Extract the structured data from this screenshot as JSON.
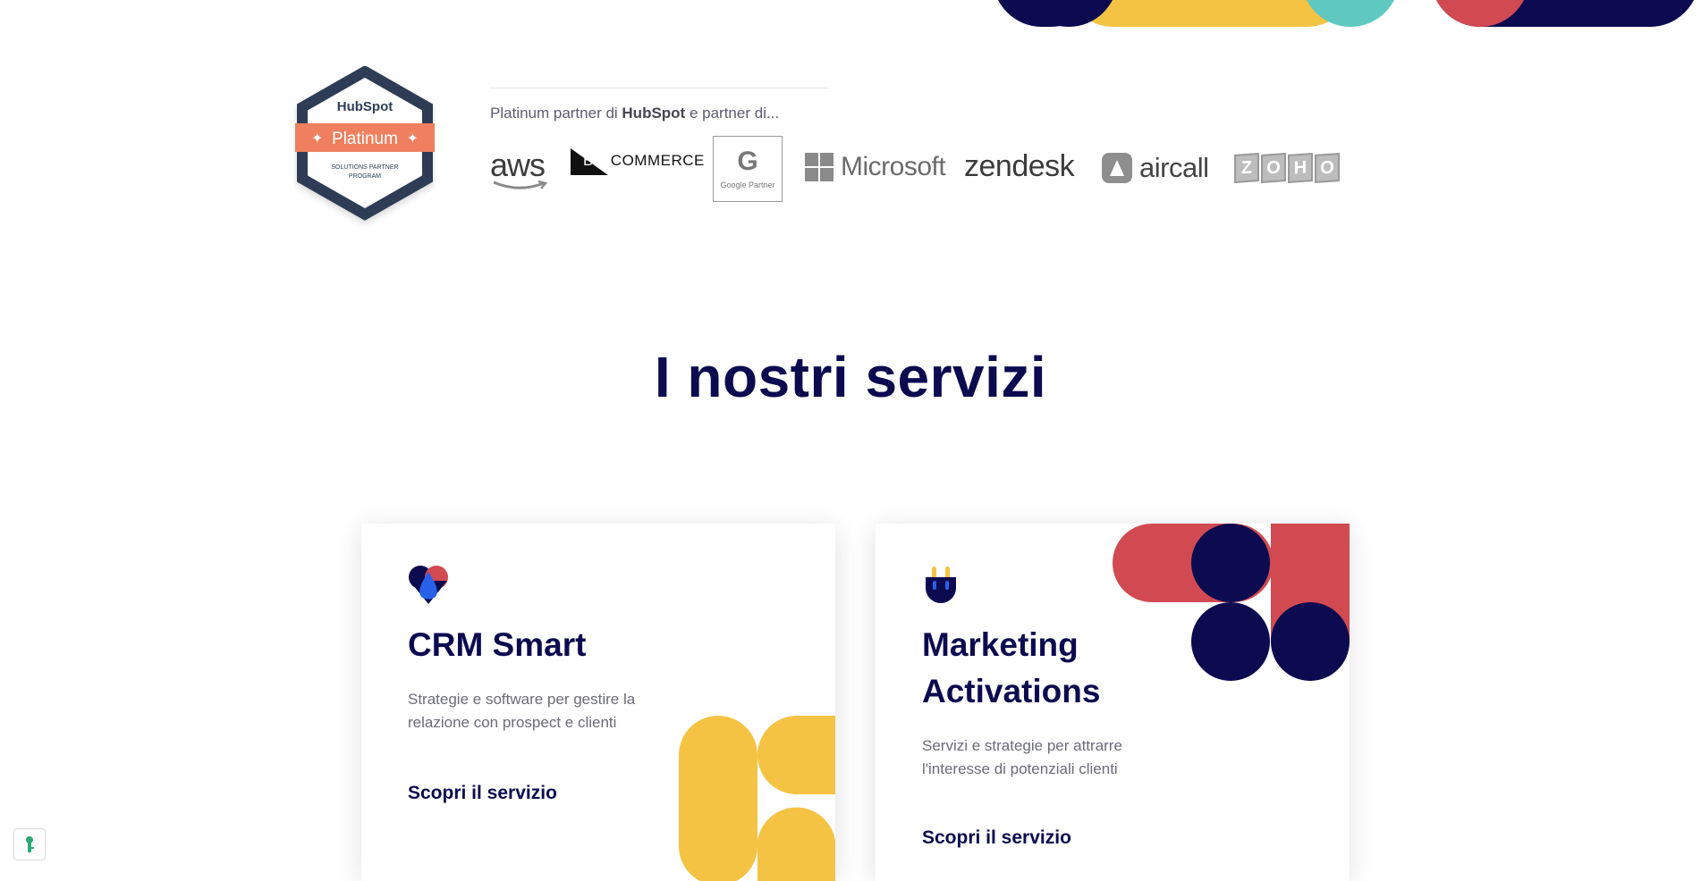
{
  "colors": {
    "navy": "#0c0b50",
    "yellow": "#f5c344",
    "teal": "#5fc9c1",
    "red": "#d14a52",
    "badge_dark": "#2f3e55",
    "badge_orange": "#ef7f5e"
  },
  "badge": {
    "brand": "HubSpot",
    "tier": "Platinum",
    "program_line1": "SOLUTIONS PARTNER",
    "program_line2": "PROGRAM"
  },
  "partners": {
    "intro_prefix": "Platinum partner di ",
    "intro_brand": "HubSpot",
    "intro_suffix": " e partner di...",
    "logos": {
      "aws": "aws",
      "bigcommerce_big": "BIG",
      "bigcommerce_rest": "COMMERCE",
      "google_letter": "G",
      "google_caption": "Google Partner",
      "microsoft": "Microsoft",
      "zendesk": "zendesk",
      "aircall": "aircall",
      "zoho": [
        "Z",
        "O",
        "H",
        "O"
      ]
    }
  },
  "services": {
    "title": "I nostri servizi",
    "cards": [
      {
        "title": "CRM Smart",
        "description": "Strategie e software per gestire la relazione con prospect e clienti",
        "link": "Scopri il servizio",
        "icon": "heart-drop-icon"
      },
      {
        "title_line1": "Marketing",
        "title_line2": "Activations",
        "description": "Servizi e strategie per attrarre l'interesse di potenziali clienti",
        "link": "Scopri il servizio",
        "icon": "plug-icon"
      }
    ]
  },
  "cookie_widget": {
    "icon": "cookie-settings-icon"
  }
}
